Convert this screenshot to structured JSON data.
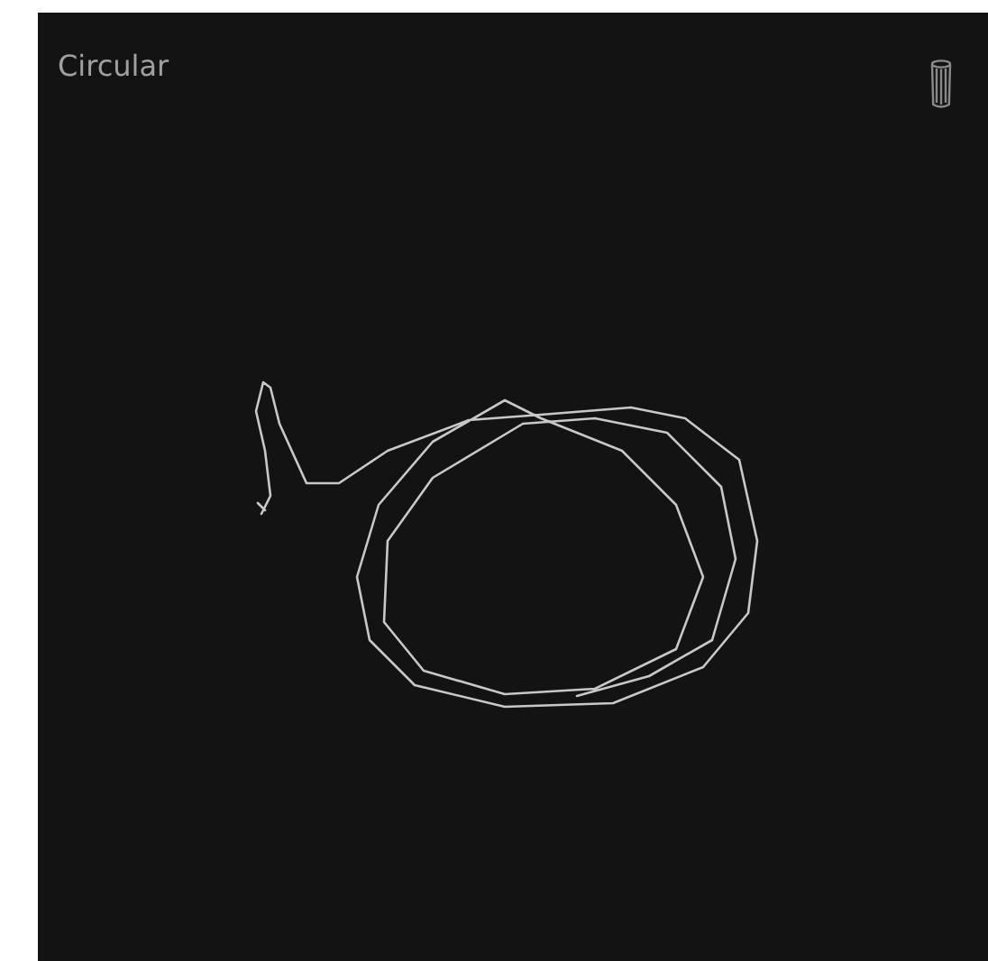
{
  "panel": {
    "title": "Circular"
  }
}
